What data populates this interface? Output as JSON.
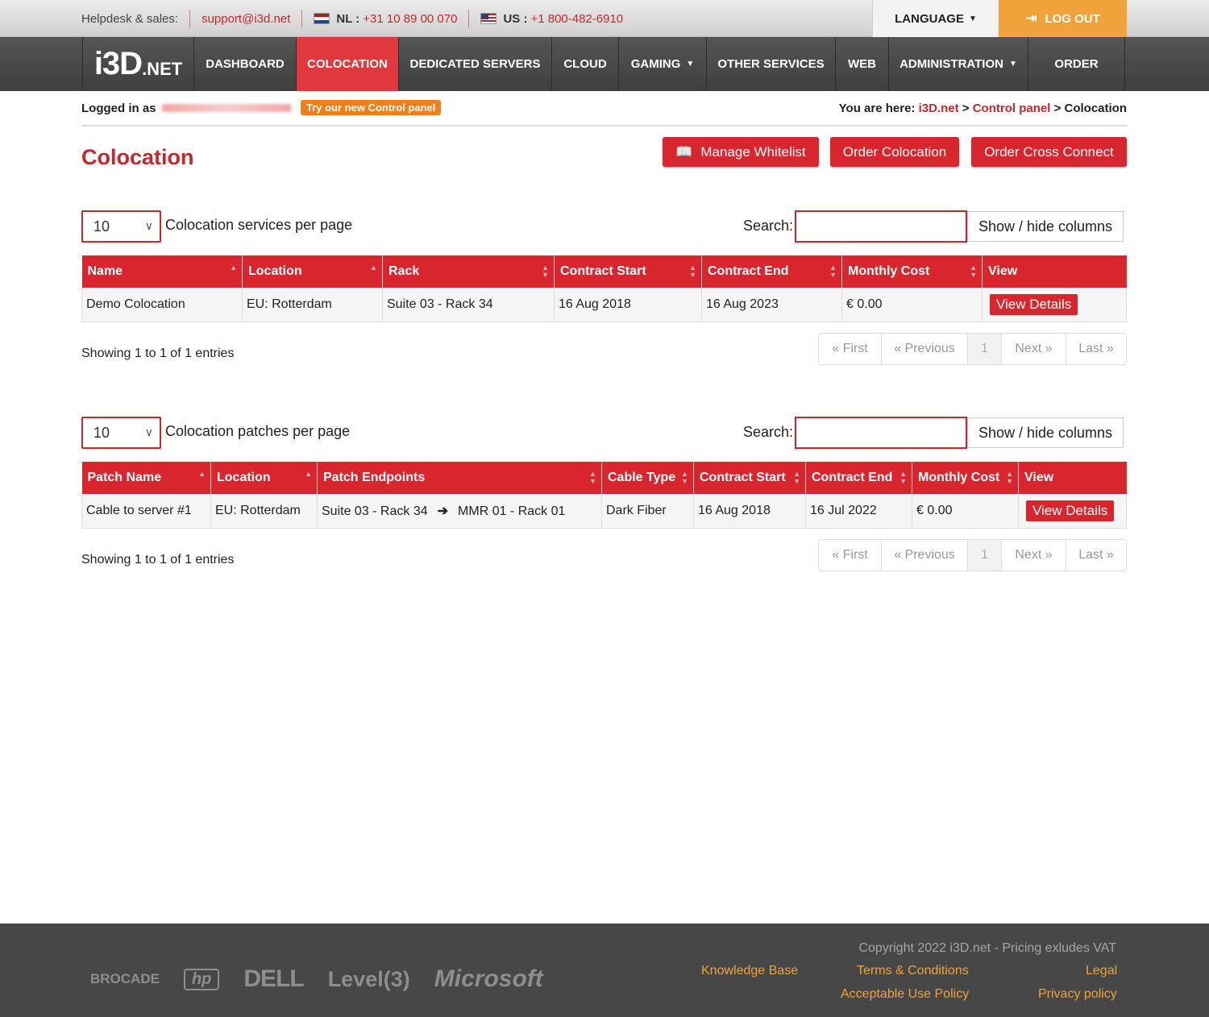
{
  "topbar": {
    "helpdesk_label": "Helpdesk & sales:",
    "email": "support@i3d.net",
    "nl_code": "NL :",
    "nl_phone": "+31 10 89 00 070",
    "us_code": "US :",
    "us_phone": "+1 800-482-6910",
    "language": "LANGUAGE",
    "logout": "LOG OUT"
  },
  "nav": {
    "logo_main": "i3D",
    "logo_sub": ".NET",
    "items": [
      "DASHBOARD",
      "COLOCATION",
      "DEDICATED SERVERS",
      "CLOUD",
      "GAMING",
      "OTHER SERVICES",
      "WEB",
      "ADMINISTRATION",
      "ORDER"
    ]
  },
  "info": {
    "logged_in": "Logged in as",
    "try_new": "Try our new Control panel",
    "here": "You are here:",
    "crumb1": "i3D.net",
    "sep": ">",
    "crumb2": "Control panel",
    "crumb3": "Colocation"
  },
  "page": {
    "title": "Colocation",
    "btn_whitelist": "Manage Whitelist",
    "btn_order_colo": "Order Colocation",
    "btn_cross": "Order Cross Connect"
  },
  "services": {
    "per_page": "10",
    "per_page_label": "Colocation services per page",
    "search_label": "Search:",
    "showhide": "Show / hide columns",
    "columns": [
      "Name",
      "Location",
      "Rack",
      "Contract Start",
      "Contract End",
      "Monthly Cost",
      "View"
    ],
    "rows": [
      {
        "name": "Demo Colocation",
        "location": "EU: Rotterdam",
        "rack": "Suite 03 - Rack 34",
        "start": "16 Aug 2018",
        "end": "16 Aug 2023",
        "cost": "€ 0.00",
        "view": "View Details"
      }
    ],
    "showing": "Showing 1 to 1 of 1 entries"
  },
  "patches": {
    "per_page": "10",
    "per_page_label": "Colocation patches per page",
    "search_label": "Search:",
    "showhide": "Show / hide columns",
    "columns": [
      "Patch Name",
      "Location",
      "Patch Endpoints",
      "Cable Type",
      "Contract Start",
      "Contract End",
      "Monthly Cost",
      "View"
    ],
    "rows": [
      {
        "name": "Cable to server #1",
        "location": "EU: Rotterdam",
        "from": "Suite 03 - Rack 34",
        "to": "MMR 01 - Rack 01",
        "cable": "Dark Fiber",
        "start": "16 Aug 2018",
        "end": "16 Jul 2022",
        "cost": "€ 0.00",
        "view": "View Details"
      }
    ],
    "showing": "Showing 1 to 1 of 1 entries"
  },
  "pager": {
    "first": "« First",
    "prev": "« Previous",
    "page": "1",
    "next": "Next »",
    "last": "Last »"
  },
  "footer": {
    "brands": [
      "BROCADE",
      "hp",
      "DELL",
      "Level(3)",
      "Microsoft"
    ],
    "copyright": "Copyright 2022 i3D.net - Pricing exludes VAT",
    "kb": "Knowledge Base",
    "terms": "Terms & Conditions",
    "legal": "Legal",
    "aup": "Acceptable Use Policy",
    "privacy": "Privacy policy"
  }
}
